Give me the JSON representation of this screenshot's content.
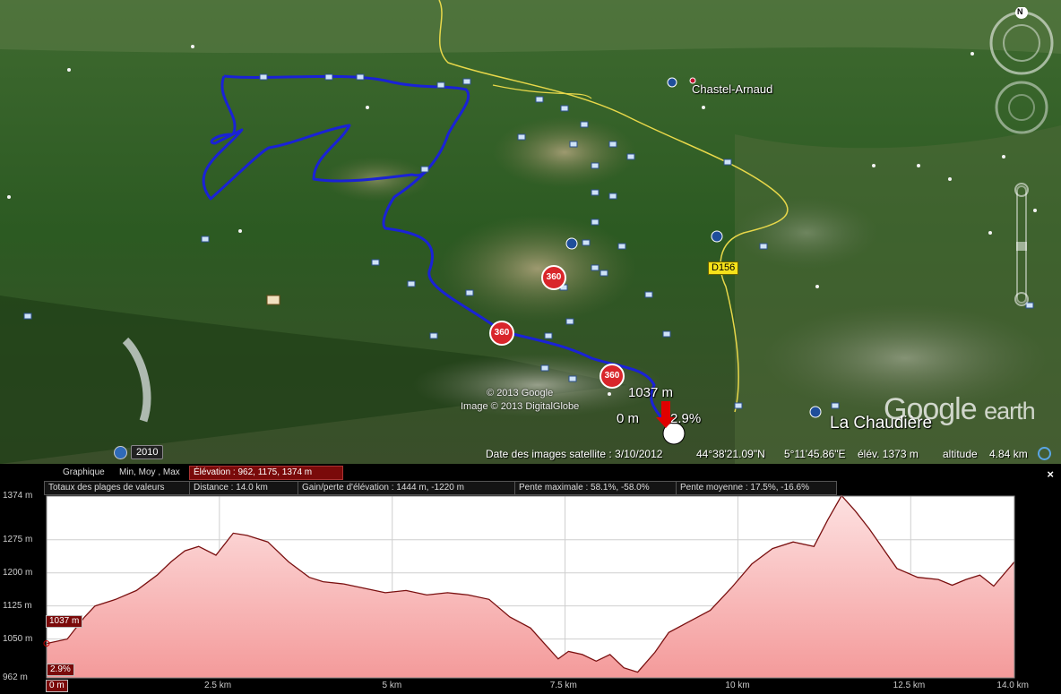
{
  "map": {
    "places": {
      "chastel": "Chastel-Arnaud",
      "chaudiere": "La Chaudière",
      "road": "D156"
    },
    "cursor": {
      "elevation": "1037 m",
      "distance": "0 m",
      "slope": "2.9%"
    },
    "copyright": {
      "line1": "© 2013 Google",
      "line2": "Image © 2013 DigitalGlobe"
    },
    "logo": {
      "google": "Google",
      "earth": "earth"
    },
    "history": {
      "year": "2010"
    },
    "compass": {
      "north": "N"
    },
    "status": {
      "date": "Date des images satellite : 3/10/2012",
      "lat": "44°38'21.09\"N",
      "lon": "5°11'45.86\"E",
      "elev": "élév. 1373 m",
      "alt_label": "altitude",
      "alt_value": "4.84 km"
    },
    "badges": [
      "360",
      "360",
      "360"
    ],
    "colors": {
      "route": "#1a22d6",
      "road": "#e8d84a"
    }
  },
  "profile": {
    "graph_label": "Graphique",
    "mode": "Min, Moy , Max",
    "elevation": "Élévation : 962, 1175, 1374 m",
    "totals_label": "Totaux des plages de valeurs",
    "distance": "Distance : 14.0 km",
    "gain": "Gain/perte d'élévation : 1444 m, -1220 m",
    "max_slope": "Pente maximale : 58.1%, -58.0%",
    "avg_slope": "Pente moyenne : 17.5%, -16.6%",
    "close": "×",
    "cursor_elev": "1037 m",
    "cursor_slope": "2.9%",
    "cursor_dist": "0 m"
  },
  "chart_data": {
    "type": "area",
    "xlabel": "",
    "ylabel": "",
    "x_ticks": [
      "0 m",
      "2.5 km",
      "5 km",
      "7.5 km",
      "10 km",
      "12.5 km",
      "14.0 km"
    ],
    "y_ticks": [
      "1374 m",
      "1275 m",
      "1200 m",
      "1125 m",
      "1050 m",
      "962 m"
    ],
    "xlim": [
      0,
      14.0
    ],
    "ylim": [
      962,
      1374
    ],
    "grid": true,
    "series": [
      {
        "x": [
          0,
          0.3,
          0.55,
          0.7,
          1.0,
          1.3,
          1.6,
          1.8,
          2.0,
          2.2,
          2.45,
          2.7,
          2.9,
          3.2,
          3.5,
          3.8,
          4.0,
          4.3,
          4.6,
          4.9,
          5.2,
          5.5,
          5.8,
          6.1,
          6.4,
          6.7,
          7.0,
          7.2,
          7.4,
          7.55,
          7.75,
          7.95,
          8.15,
          8.35,
          8.55,
          8.8,
          9.0,
          9.3,
          9.6,
          9.9,
          10.2,
          10.5,
          10.8,
          11.1,
          11.3,
          11.5,
          11.7,
          11.9,
          12.1,
          12.3,
          12.6,
          12.9,
          13.1,
          13.3,
          13.5,
          13.7,
          14.0
        ],
        "y": [
          1040,
          1050,
          1100,
          1125,
          1140,
          1160,
          1195,
          1225,
          1250,
          1260,
          1240,
          1290,
          1285,
          1270,
          1225,
          1190,
          1180,
          1175,
          1165,
          1155,
          1160,
          1150,
          1155,
          1150,
          1140,
          1100,
          1075,
          1040,
          1005,
          1022,
          1015,
          1000,
          1015,
          985,
          975,
          1020,
          1065,
          1090,
          1115,
          1165,
          1220,
          1255,
          1270,
          1260,
          1320,
          1375,
          1340,
          1300,
          1255,
          1210,
          1190,
          1185,
          1172,
          1185,
          1195,
          1170,
          1225
        ]
      }
    ]
  }
}
